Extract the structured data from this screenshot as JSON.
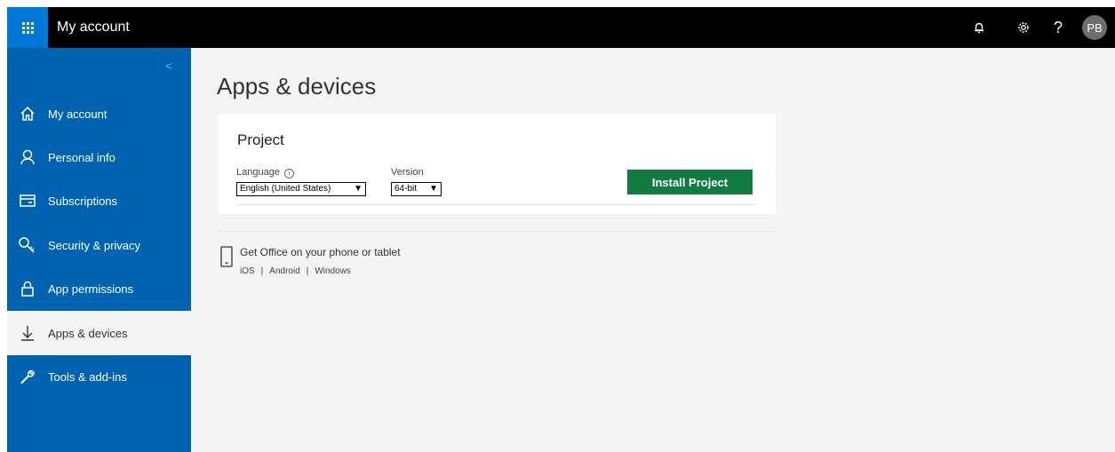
{
  "header": {
    "title": "My account",
    "avatar_initials": "PB",
    "help_label": "?"
  },
  "sidebar": {
    "collapse_glyph": "<",
    "items": [
      {
        "label": "My account",
        "icon": "home-icon"
      },
      {
        "label": "Personal info",
        "icon": "person-icon"
      },
      {
        "label": "Subscriptions",
        "icon": "card-icon"
      },
      {
        "label": "Security & privacy",
        "icon": "key-icon"
      },
      {
        "label": "App permissions",
        "icon": "lock-icon"
      },
      {
        "label": "Apps & devices",
        "icon": "download-icon"
      },
      {
        "label": "Tools & add-ins",
        "icon": "wrench-icon"
      }
    ],
    "active_index": 5
  },
  "main": {
    "title": "Apps & devices",
    "product": {
      "name": "Project",
      "language_label": "Language",
      "language_value": "English (United States)",
      "version_label": "Version",
      "version_value": "64-bit",
      "install_label": "Install Project"
    },
    "mobile": {
      "heading": "Get Office on your phone or tablet",
      "links": [
        "iOS",
        "Android",
        "Windows"
      ],
      "separator": "|"
    }
  },
  "colors": {
    "sidebar": "#0063b1",
    "waffle": "#0078d7",
    "install_button": "#107c41",
    "topbar": "#000000"
  }
}
